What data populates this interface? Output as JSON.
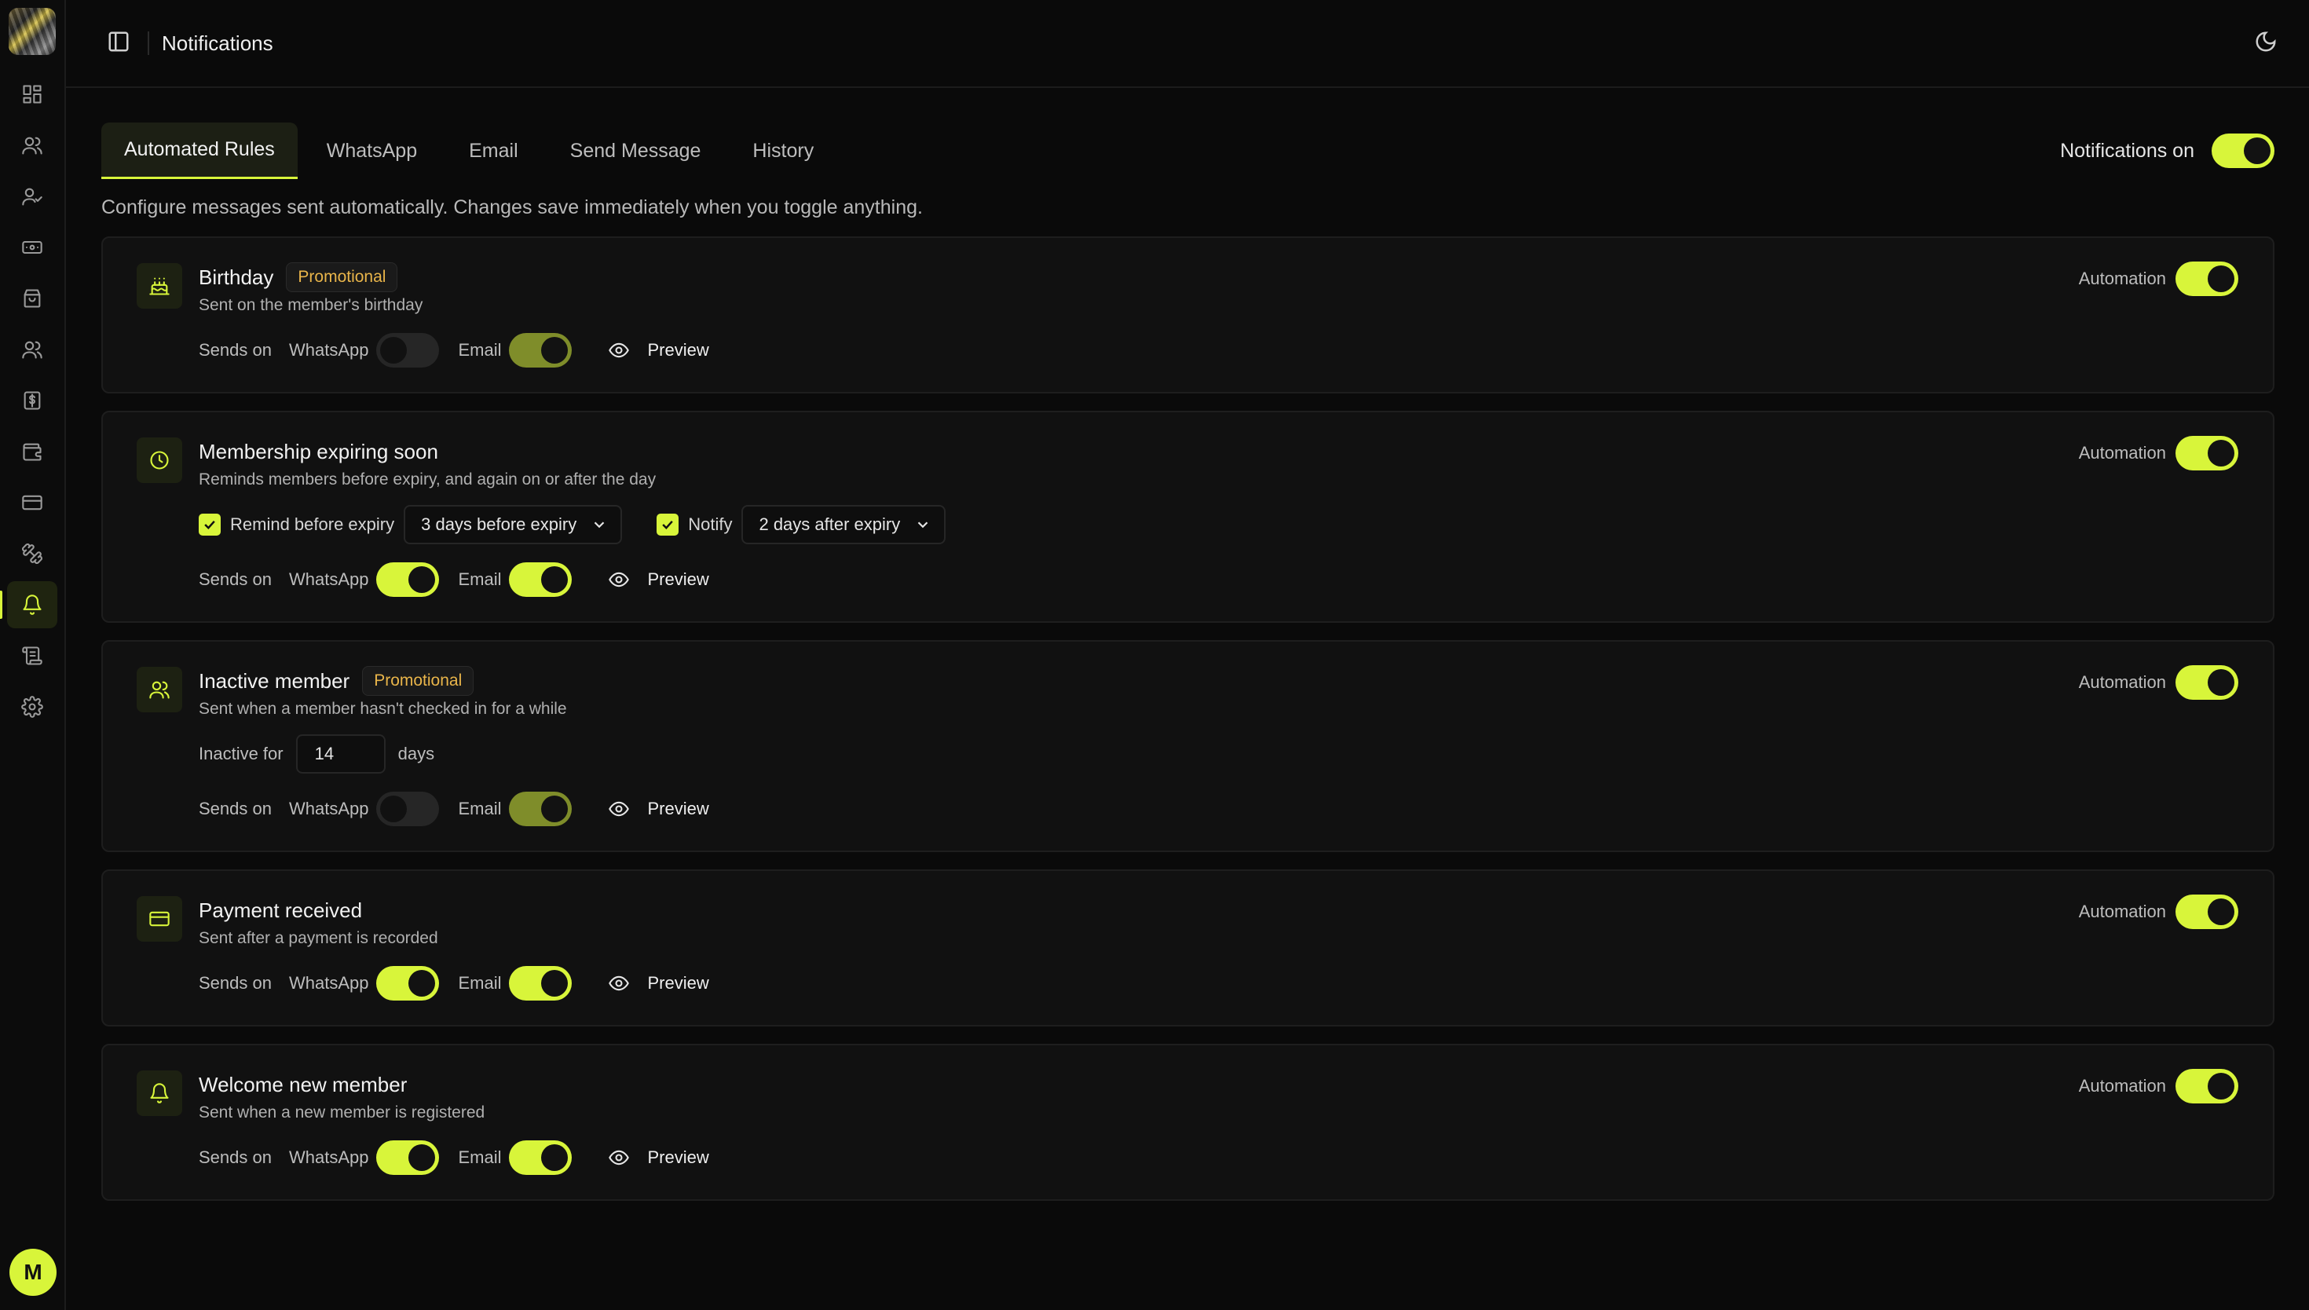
{
  "header": {
    "title": "Notifications"
  },
  "tabs": [
    {
      "label": "Automated Rules",
      "active": true
    },
    {
      "label": "WhatsApp",
      "active": false
    },
    {
      "label": "Email",
      "active": false
    },
    {
      "label": "Send Message",
      "active": false
    },
    {
      "label": "History",
      "active": false
    }
  ],
  "notifications_toggle": {
    "label": "Notifications on",
    "on": true
  },
  "subtitle": "Configure messages sent automatically. Changes save immediately when you toggle anything.",
  "common": {
    "automation_label": "Automation",
    "sends_on_label": "Sends on",
    "whatsapp_label": "WhatsApp",
    "email_label": "Email",
    "preview_label": "Preview"
  },
  "rules": {
    "birthday": {
      "title": "Birthday",
      "badge": "Promotional",
      "desc": "Sent on the member's birthday",
      "automation": true,
      "whatsapp": false,
      "email": true
    },
    "expiring": {
      "title": "Membership expiring soon",
      "desc": "Reminds members before expiry, and again on or after the day",
      "remind_label": "Remind before expiry",
      "remind_value": "3 days before expiry",
      "notify_label": "Notify",
      "notify_value": "2 days after expiry",
      "automation": true,
      "whatsapp": true,
      "email": true
    },
    "inactive": {
      "title": "Inactive member",
      "badge": "Promotional",
      "desc": "Sent when a member hasn't checked in for a while",
      "inactive_label": "Inactive for",
      "inactive_value": "14",
      "inactive_unit": "days",
      "automation": true,
      "whatsapp": false,
      "email": true
    },
    "payment": {
      "title": "Payment received",
      "desc": "Sent after a payment is recorded",
      "automation": true,
      "whatsapp": true,
      "email": true
    },
    "welcome": {
      "title": "Welcome new member",
      "desc": "Sent when a new member is registered",
      "automation": true,
      "whatsapp": true,
      "email": true
    }
  },
  "user": {
    "initial": "M"
  },
  "colors": {
    "accent": "#d8f53a",
    "promo": "#e9b54a",
    "background": "#0a0a0a"
  }
}
